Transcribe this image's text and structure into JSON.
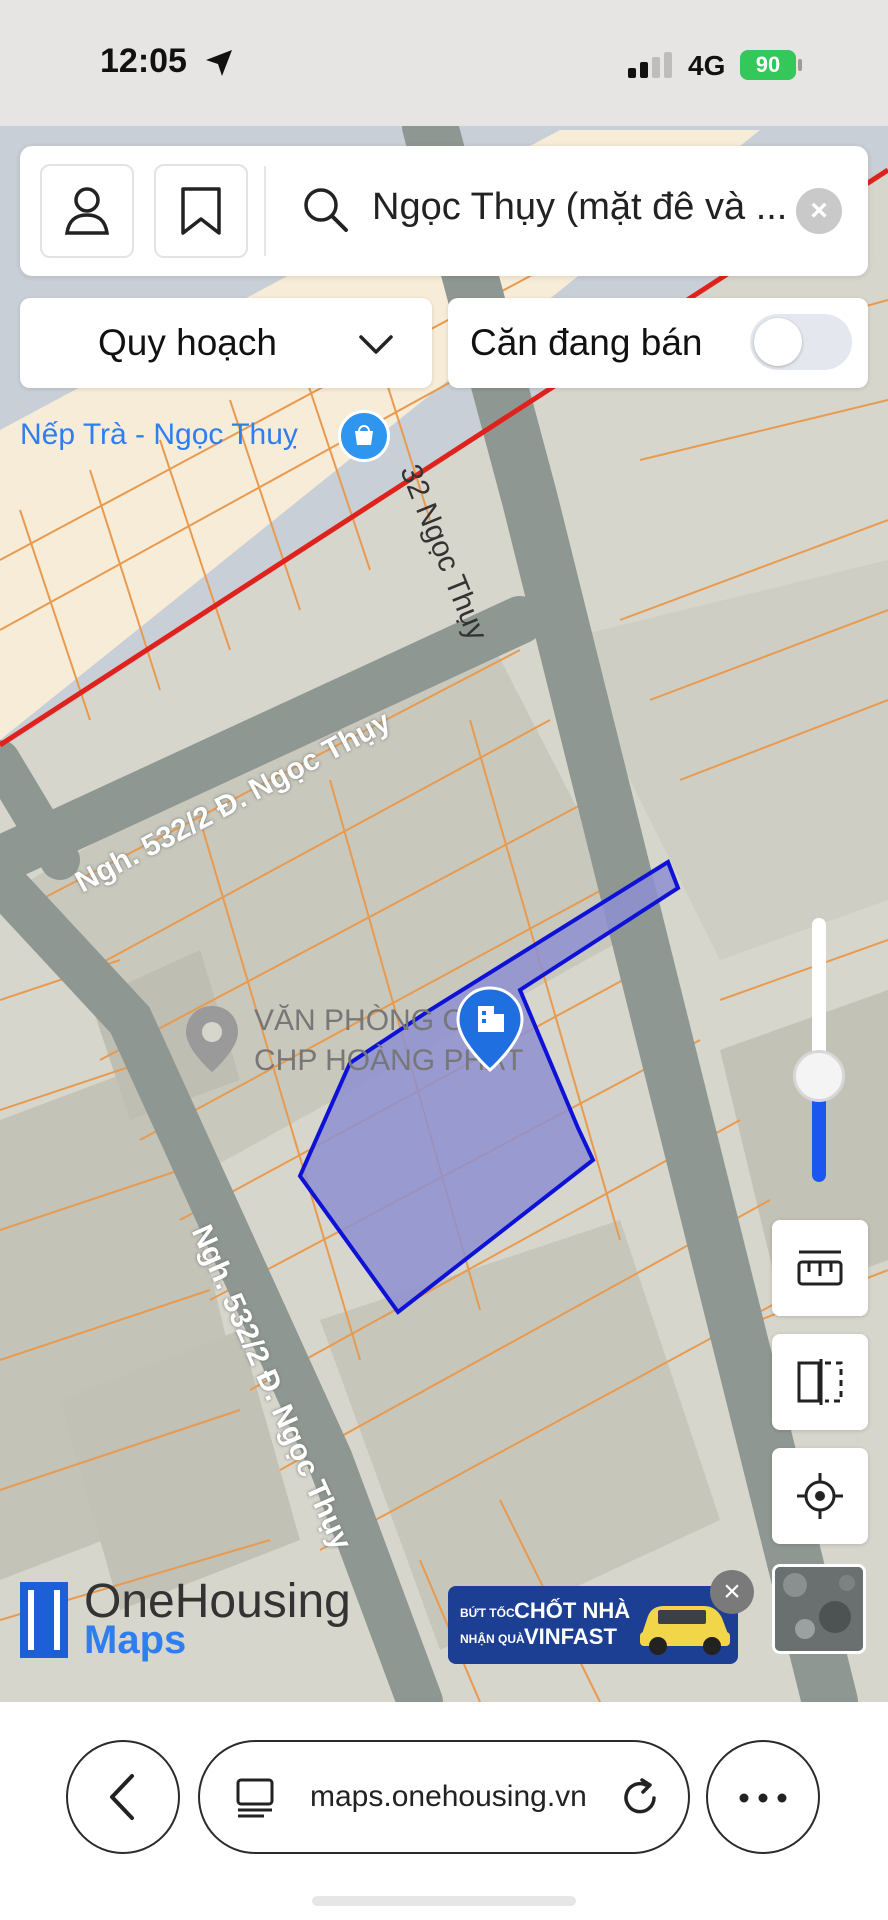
{
  "status_bar": {
    "time": "12:05",
    "network": "4G",
    "battery": "90"
  },
  "search": {
    "query": "Ngọc Thụy (mặt đê và ...",
    "clear_label": "×"
  },
  "filters": {
    "planning_label": "Quy hoạch",
    "for_sale_label": "Căn đang bán",
    "for_sale_enabled": false
  },
  "map": {
    "poi_shop": "Nếp Trà - Ngọc Thuỵ",
    "road_top": "32 Ngọc Thụy",
    "road_alley_a": "Ngh. 532/2 Đ. Ngọc Thụy",
    "road_alley_b": "Ngh. 532/2 Đ. Ngọc Thụy",
    "poi_office_line1": "VĂN PHÒNG C",
    "poi_office_line2": "CHP HOÀNG PHÁT",
    "zoom_level": 0.4
  },
  "brand": {
    "name_top": "OneHousing",
    "name_bottom": "Maps"
  },
  "ad": {
    "line1_small": "BỨT TỐC",
    "line1_big": "CHỐT NHÀ",
    "line2_small": "NHẬN QUÀ",
    "line2_big": "VINFAST",
    "close_label": "×"
  },
  "browser": {
    "url": "maps.onehousing.vn"
  },
  "colors": {
    "accent": "#1a56f0",
    "parcel_fill": "#8e8fd0",
    "parcel_stroke": "#0d12d6",
    "plan_boundary": "#e0221c",
    "lot_lines": "#e89a4f",
    "road": "#8f9792"
  }
}
